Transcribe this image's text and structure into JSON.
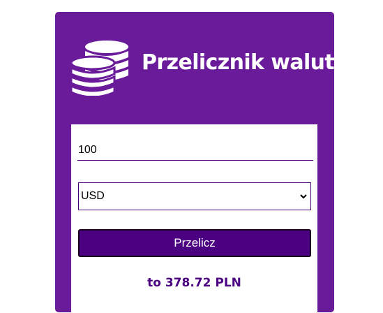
{
  "header": {
    "title": "Przelicznik walut",
    "icon": "coins-icon"
  },
  "form": {
    "amount_value": "100",
    "currency_selected": "USD",
    "convert_label": "Przelicz"
  },
  "result": {
    "text": "to 378.72 PLN"
  },
  "colors": {
    "card_background": "#6a1b9a",
    "button_background": "#4a0080",
    "result_text": "#4a0080",
    "panel_background": "#ffffff"
  }
}
